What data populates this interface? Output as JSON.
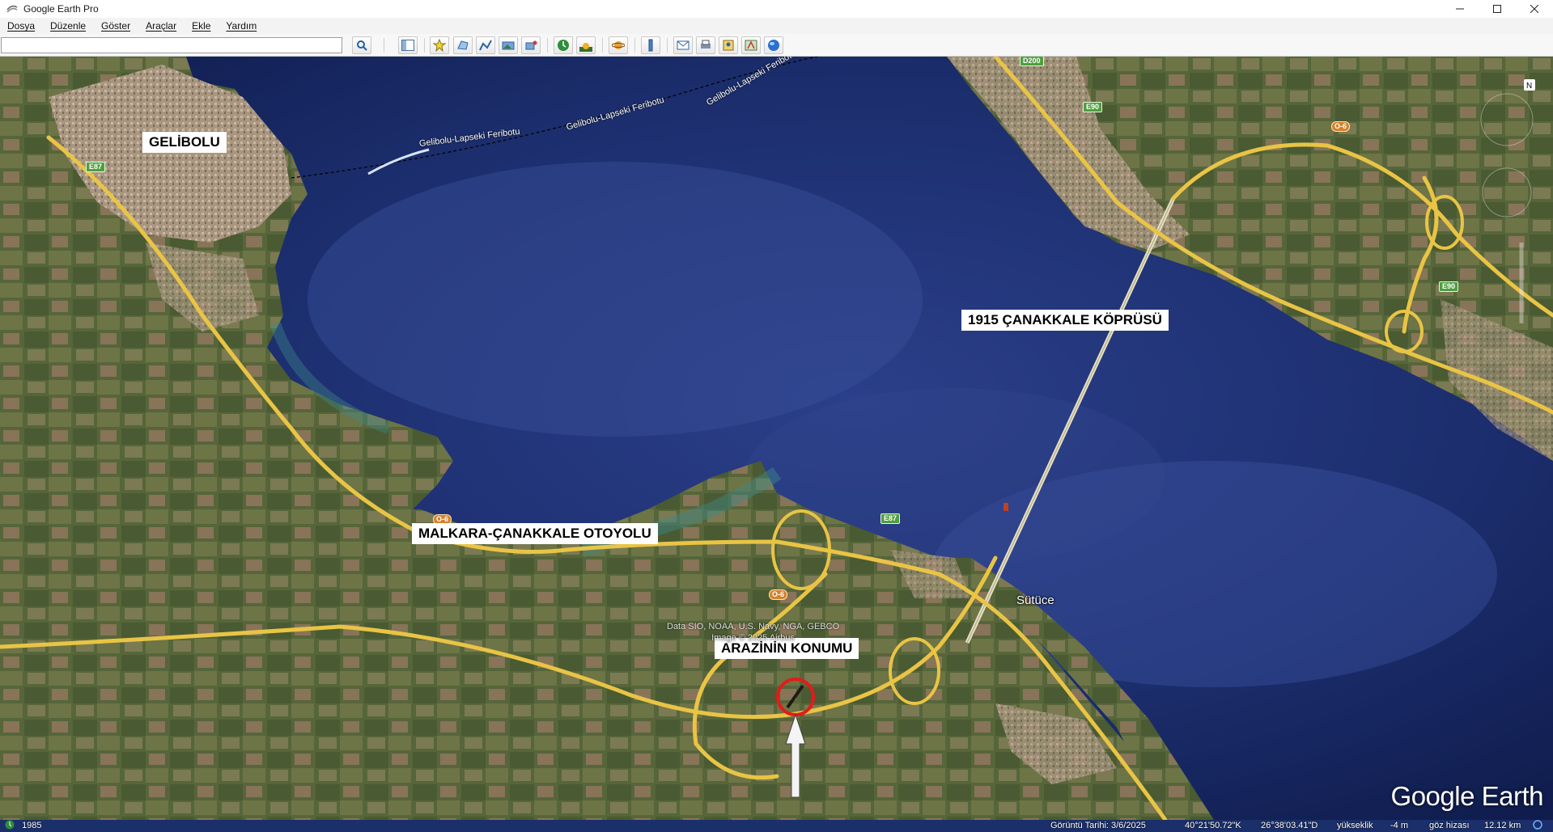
{
  "window": {
    "title": "Google Earth Pro"
  },
  "menu": [
    "Dosya",
    "Düzenle",
    "Göster",
    "Araçlar",
    "Ekle",
    "Yardım"
  ],
  "search": {
    "value": "",
    "placeholder": ""
  },
  "toolbar_icons": [
    "search-icon",
    "sidebar-toggle-icon",
    "placemark-icon",
    "polygon-icon",
    "path-icon",
    "image-overlay-icon",
    "record-tour-icon",
    "historical-imagery-icon",
    "sunlight-icon",
    "planets-icon",
    "ruler-icon",
    "email-icon",
    "print-icon",
    "save-image-icon",
    "view-in-maps-icon",
    "earth-gallery-icon"
  ],
  "map": {
    "labels": {
      "gelibolu": "GELİBOLU",
      "bridge": "1915 ÇANAKKALE KÖPRÜSÜ",
      "highway": "MALKARA-ÇANAKKALE OTOYOLU",
      "location": "ARAZİNİN KONUMU"
    },
    "place_names": {
      "sutuce": "Sütüce"
    },
    "ferry": [
      "Gelibolu-Lapseki Feribotu",
      "Gelibolu-Lapseki Feribotu",
      "Gelibolu-Lapseki Feribotu"
    ],
    "road_shields": [
      "D200",
      "E90",
      "O-6",
      "E87",
      "E90",
      "E87",
      "O-6",
      "O-6"
    ],
    "attribution": [
      "Data SIO, NOAA, U.S. Navy, NGA, GEBCO",
      "Image © 2025 Airbus"
    ],
    "logo": "Google Earth"
  },
  "status": {
    "year": "1985",
    "date": "Görüntü Tarihi: 3/6/2025",
    "lat": "40°21'50.72\"K",
    "lon": "26°38'03.41\"D",
    "elev_label": "yükseklik",
    "elev": "-4 m",
    "eye_label": "göz hizası",
    "eye": "12.12 km"
  },
  "colors": {
    "water": "#1e3475",
    "land": "#5b6b3e",
    "road": "#e8c040",
    "marker": "#e21b1b"
  }
}
